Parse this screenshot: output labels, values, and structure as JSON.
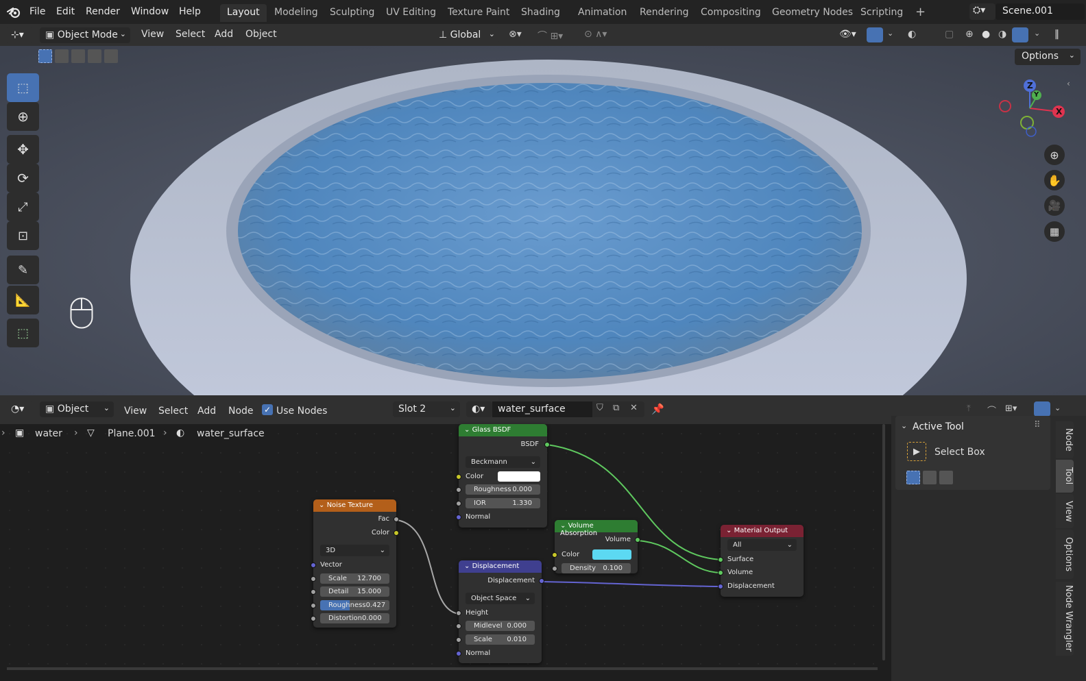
{
  "topbar": {
    "menus": [
      "File",
      "Edit",
      "Render",
      "Window",
      "Help"
    ],
    "workspaces": [
      "Layout",
      "Modeling",
      "Sculpting",
      "UV Editing",
      "Texture Paint",
      "Shading",
      "Animation",
      "Rendering",
      "Compositing",
      "Geometry Nodes",
      "Scripting"
    ],
    "active_workspace": "Layout",
    "scene": "Scene.001"
  },
  "viewport_header": {
    "mode": "Object Mode",
    "menus": [
      "View",
      "Select",
      "Add",
      "Object"
    ],
    "orientation": "Global",
    "options": "Options"
  },
  "gizmo": {
    "z": "Z",
    "y": "Y",
    "x": "X"
  },
  "node_header": {
    "editor_type": "Object",
    "menus": [
      "View",
      "Select",
      "Add",
      "Node"
    ],
    "use_nodes": "Use Nodes",
    "slot": "Slot 2",
    "material": "water_surface"
  },
  "breadcrumb": {
    "object": "water",
    "mesh": "Plane.001",
    "material": "water_surface"
  },
  "nodes": {
    "glass": {
      "title": "Glass BSDF",
      "out": "BSDF",
      "distribution": "Beckmann",
      "color_label": "Color",
      "roughness_label": "Roughness",
      "roughness": "0.000",
      "ior_label": "IOR",
      "ior": "1.330",
      "normal": "Normal"
    },
    "noise": {
      "title": "Noise Texture",
      "fac": "Fac",
      "color": "Color",
      "dim": "3D",
      "vector": "Vector",
      "scale_label": "Scale",
      "scale": "12.700",
      "detail_label": "Detail",
      "detail": "15.000",
      "rough_label": "Roughness",
      "rough": "0.427",
      "distortion_label": "Distortion",
      "distortion": "0.000"
    },
    "disp": {
      "title": "Displacement",
      "out": "Displacement",
      "space": "Object Space",
      "height": "Height",
      "midlevel_label": "Midlevel",
      "midlevel": "0.000",
      "scale_label": "Scale",
      "scale": "0.010",
      "normal": "Normal"
    },
    "vol": {
      "title": "Volume Absorption",
      "out": "Volume",
      "color_label": "Color",
      "density_label": "Density",
      "density": "0.100"
    },
    "out": {
      "title": "Material Output",
      "target": "All",
      "surface": "Surface",
      "volume": "Volume",
      "displacement": "Displacement"
    }
  },
  "sidepanel": {
    "header": "Active Tool",
    "tool": "Select Box",
    "tabs": [
      "Node",
      "Tool",
      "View",
      "Options",
      "Node Wrangler"
    ]
  },
  "colors": {
    "accent": "#4772b3",
    "glass_header": "#2e7d32",
    "noise_header": "#b35f1a",
    "disp_header": "#3f3f8f",
    "vol_header": "#2e7d32",
    "out_header": "#7a2233",
    "vol_color": "#5cd9f2"
  }
}
